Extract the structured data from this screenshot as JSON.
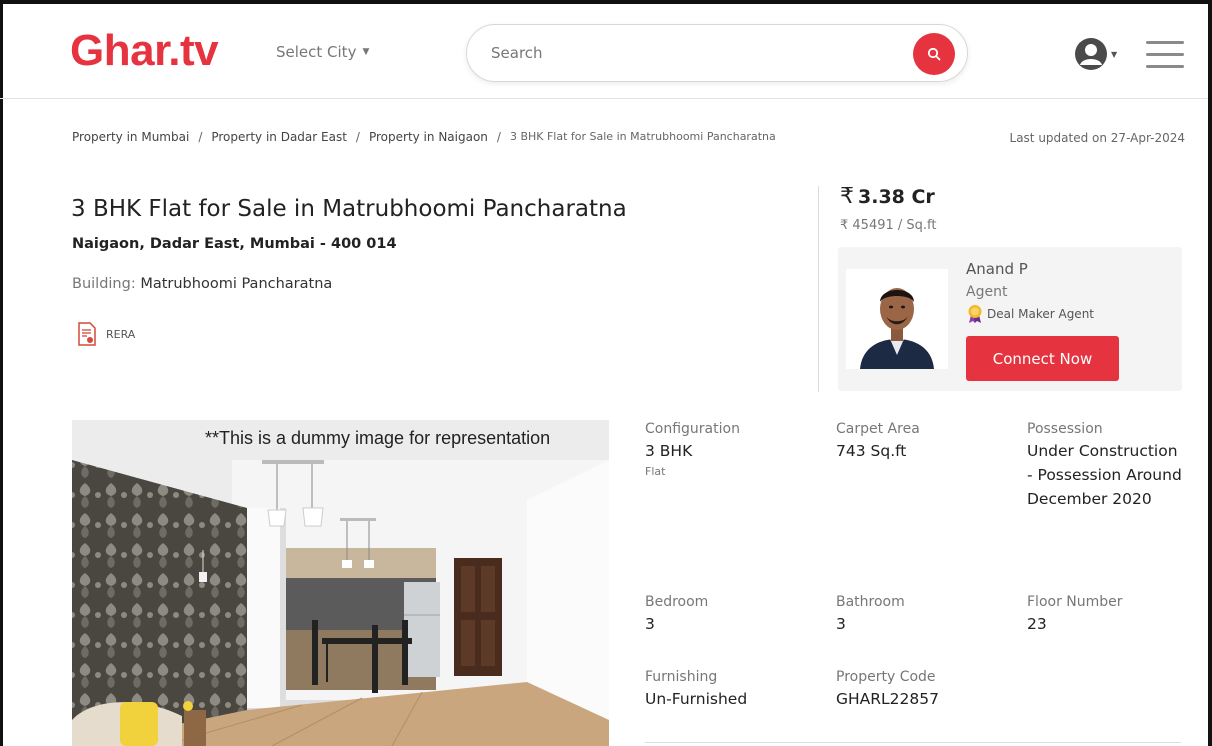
{
  "header": {
    "logo": "Ghar.tv",
    "city_select": "Select City",
    "search_placeholder": "Search"
  },
  "breadcrumb": {
    "items": [
      "Property in Mumbai",
      "Property in Dadar East",
      "Property in Naigaon"
    ],
    "current": "3 BHK Flat for Sale in Matrubhoomi Pancharatna",
    "separator": "/"
  },
  "last_updated": "Last updated on 27-Apr-2024",
  "listing": {
    "title": "3 BHK Flat for Sale in Matrubhoomi Pancharatna",
    "address": "Naigaon, Dadar East, Mumbai - 400 014",
    "building_label": "Building:",
    "building_name": "Matrubhoomi Pancharatna",
    "rera_label": "RERA"
  },
  "price": {
    "currency_symbol": "₹",
    "amount": "3.38 Cr",
    "per_sqft": "₹ 45491 / Sq.ft"
  },
  "agent": {
    "name": "Anand P",
    "role": "Agent",
    "badge": "Deal Maker Agent",
    "cta": "Connect Now"
  },
  "image_note": "**This is a dummy image for representation",
  "details": {
    "configuration": {
      "label": "Configuration",
      "value": "3 BHK",
      "sub": "Flat"
    },
    "carpet_area": {
      "label": "Carpet Area",
      "value": "743 Sq.ft"
    },
    "possession": {
      "label": "Possession",
      "value": "Under Construction - Possession Around December 2020"
    },
    "bedroom": {
      "label": "Bedroom",
      "value": "3"
    },
    "bathroom": {
      "label": "Bathroom",
      "value": "3"
    },
    "floor_number": {
      "label": "Floor Number",
      "value": "23"
    },
    "furnishing": {
      "label": "Furnishing",
      "value": "Un-Furnished"
    },
    "property_code": {
      "label": "Property Code",
      "value": "GHARL22857"
    }
  },
  "colors": {
    "brand": "#e5343f",
    "text": "#222222",
    "muted": "#777777"
  },
  "icons": [
    "search-icon",
    "user-avatar-icon",
    "hamburger-menu-icon",
    "rera-document-icon",
    "award-badge-icon"
  ]
}
